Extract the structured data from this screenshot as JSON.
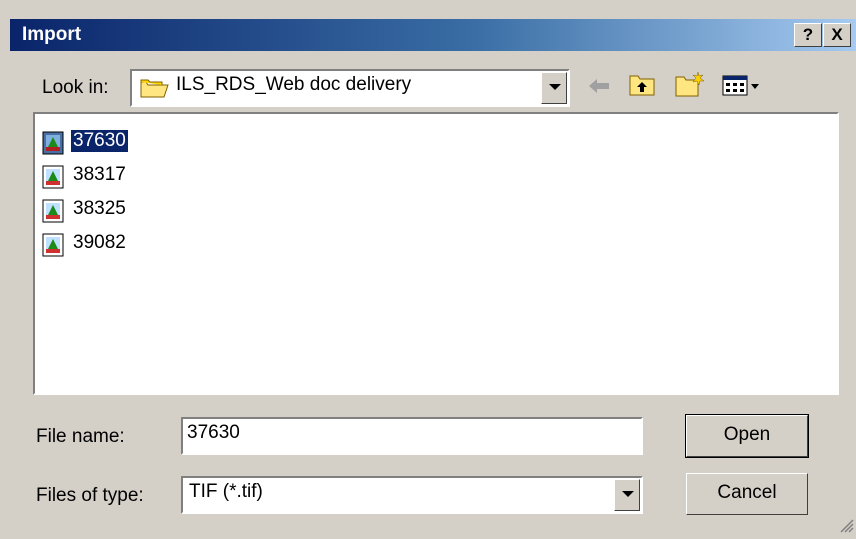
{
  "window": {
    "title": "Import",
    "help_label": "?",
    "close_label": "X"
  },
  "lookin": {
    "label": "Look in:",
    "folder": "ILS_RDS_Web doc delivery"
  },
  "toolbar": {
    "back_icon": "back-arrow-icon",
    "up_icon": "up-folder-icon",
    "new_folder_icon": "new-folder-icon",
    "view_menu_icon": "view-menu-icon"
  },
  "files": [
    {
      "name": "37630",
      "selected": true
    },
    {
      "name": "38317",
      "selected": false
    },
    {
      "name": "38325",
      "selected": false
    },
    {
      "name": "39082",
      "selected": false
    }
  ],
  "filename": {
    "label": "File name:",
    "value": "37630"
  },
  "filetype": {
    "label": "Files of type:",
    "value": "TIF (*.tif)"
  },
  "buttons": {
    "open": "Open",
    "cancel": "Cancel"
  },
  "colors": {
    "title_start": "#0a246a",
    "title_end": "#a6caf0",
    "selection": "#0a246a",
    "face": "#d4d0c8"
  }
}
